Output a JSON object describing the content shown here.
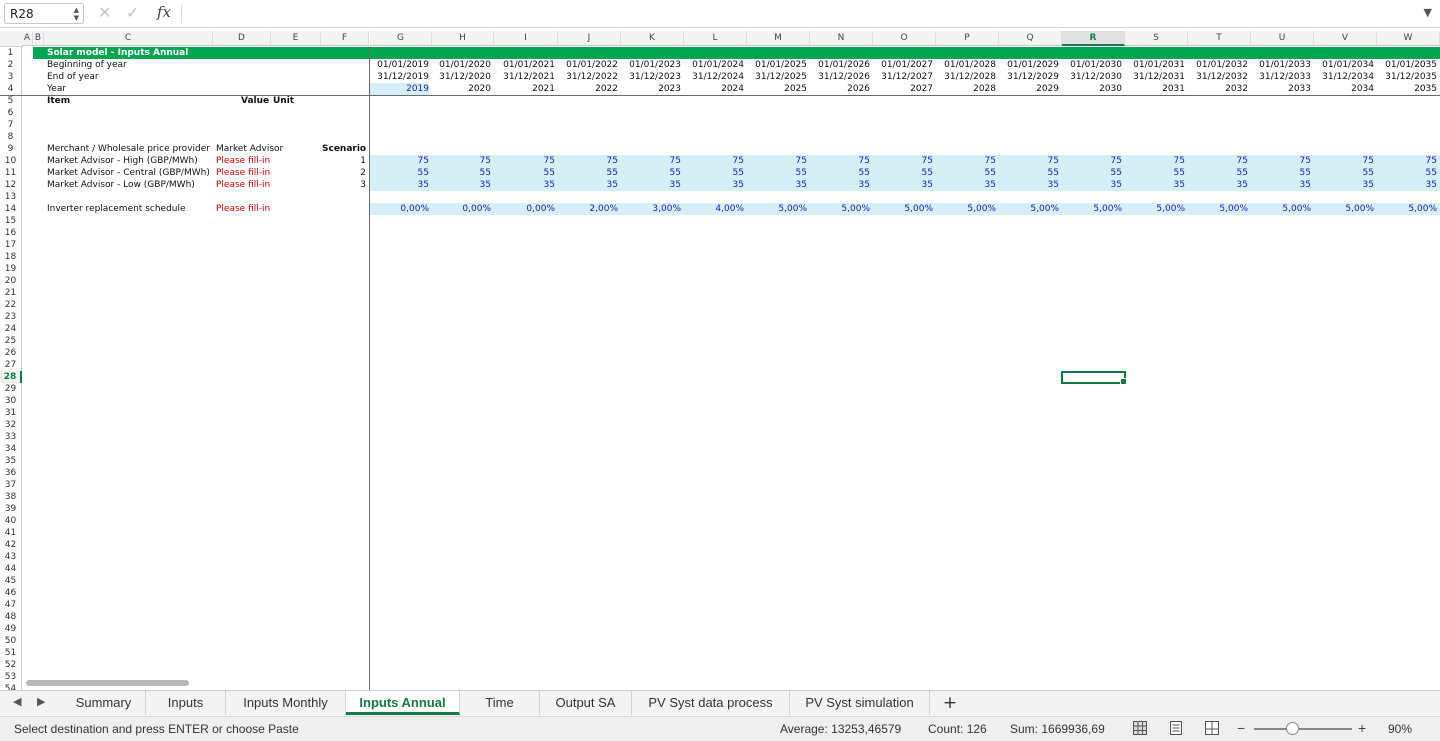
{
  "formula_bar": {
    "cell_ref": "R28",
    "fx_label": "fx",
    "formula": ""
  },
  "columns": [
    {
      "id": "A",
      "label": "A"
    },
    {
      "id": "B",
      "label": "B"
    },
    {
      "id": "C",
      "label": "C"
    },
    {
      "id": "D",
      "label": "D"
    },
    {
      "id": "E",
      "label": "E"
    },
    {
      "id": "F",
      "label": "F"
    },
    {
      "id": "G",
      "label": "G"
    },
    {
      "id": "H",
      "label": "H"
    },
    {
      "id": "I",
      "label": "I"
    },
    {
      "id": "J",
      "label": "J"
    },
    {
      "id": "K",
      "label": "K"
    },
    {
      "id": "L",
      "label": "L"
    },
    {
      "id": "M",
      "label": "M"
    },
    {
      "id": "N",
      "label": "N"
    },
    {
      "id": "O",
      "label": "O"
    },
    {
      "id": "P",
      "label": "P"
    },
    {
      "id": "Q",
      "label": "Q"
    },
    {
      "id": "R",
      "label": "R"
    },
    {
      "id": "S",
      "label": "S"
    },
    {
      "id": "T",
      "label": "T"
    },
    {
      "id": "U",
      "label": "U"
    },
    {
      "id": "V",
      "label": "V"
    },
    {
      "id": "W",
      "label": "W"
    }
  ],
  "selected_column": "R",
  "selected_row": 28,
  "row_count": 54,
  "sheet": {
    "title": "Solar model - Inputs Annual",
    "labels": {
      "beginning": "Beginning of year",
      "end": "End of year",
      "year": "Year",
      "item": "Item",
      "value": "Value",
      "unit": "Unit",
      "provider": "Merchant / Wholesale price provider",
      "provider_value": "Market Advisor",
      "scenario": "Scenario",
      "high": "Market Advisor - High (GBP/MWh)",
      "central": "Market Advisor - Central (GBP/MWh)",
      "low": "Market Advisor - Low (GBP/MWh)",
      "fill_in": "Please fill-in",
      "inverter": "Inverter replacement schedule"
    },
    "scenario_numbers": [
      "1",
      "2",
      "3"
    ],
    "period_columns": [
      {
        "col": "G",
        "begin": "01/01/2019",
        "end": "31/12/2019",
        "year": "2019",
        "high": "75",
        "central": "55",
        "low": "35",
        "inverter": "0,00%"
      },
      {
        "col": "H",
        "begin": "01/01/2020",
        "end": "31/12/2020",
        "year": "2020",
        "high": "75",
        "central": "55",
        "low": "35",
        "inverter": "0,00%"
      },
      {
        "col": "I",
        "begin": "01/01/2021",
        "end": "31/12/2021",
        "year": "2021",
        "high": "75",
        "central": "55",
        "low": "35",
        "inverter": "0,00%"
      },
      {
        "col": "J",
        "begin": "01/01/2022",
        "end": "31/12/2022",
        "year": "2022",
        "high": "75",
        "central": "55",
        "low": "35",
        "inverter": "2,00%"
      },
      {
        "col": "K",
        "begin": "01/01/2023",
        "end": "31/12/2023",
        "year": "2023",
        "high": "75",
        "central": "55",
        "low": "35",
        "inverter": "3,00%"
      },
      {
        "col": "L",
        "begin": "01/01/2024",
        "end": "31/12/2024",
        "year": "2024",
        "high": "75",
        "central": "55",
        "low": "35",
        "inverter": "4,00%"
      },
      {
        "col": "M",
        "begin": "01/01/2025",
        "end": "31/12/2025",
        "year": "2025",
        "high": "75",
        "central": "55",
        "low": "35",
        "inverter": "5,00%"
      },
      {
        "col": "N",
        "begin": "01/01/2026",
        "end": "31/12/2026",
        "year": "2026",
        "high": "75",
        "central": "55",
        "low": "35",
        "inverter": "5,00%"
      },
      {
        "col": "O",
        "begin": "01/01/2027",
        "end": "31/12/2027",
        "year": "2027",
        "high": "75",
        "central": "55",
        "low": "35",
        "inverter": "5,00%"
      },
      {
        "col": "P",
        "begin": "01/01/2028",
        "end": "31/12/2028",
        "year": "2028",
        "high": "75",
        "central": "55",
        "low": "35",
        "inverter": "5,00%"
      },
      {
        "col": "Q",
        "begin": "01/01/2029",
        "end": "31/12/2029",
        "year": "2029",
        "high": "75",
        "central": "55",
        "low": "35",
        "inverter": "5,00%"
      },
      {
        "col": "R",
        "begin": "01/01/2030",
        "end": "31/12/2030",
        "year": "2030",
        "high": "75",
        "central": "55",
        "low": "35",
        "inverter": "5,00%"
      },
      {
        "col": "S",
        "begin": "01/01/2031",
        "end": "31/12/2031",
        "year": "2031",
        "high": "75",
        "central": "55",
        "low": "35",
        "inverter": "5,00%"
      },
      {
        "col": "T",
        "begin": "01/01/2032",
        "end": "31/12/2032",
        "year": "2032",
        "high": "75",
        "central": "55",
        "low": "35",
        "inverter": "5,00%"
      },
      {
        "col": "U",
        "begin": "01/01/2033",
        "end": "31/12/2033",
        "year": "2033",
        "high": "75",
        "central": "55",
        "low": "35",
        "inverter": "5,00%"
      },
      {
        "col": "V",
        "begin": "01/01/2034",
        "end": "31/12/2034",
        "year": "2034",
        "high": "75",
        "central": "55",
        "low": "35",
        "inverter": "5,00%"
      },
      {
        "col": "W",
        "begin": "01/01/2035",
        "end": "31/12/2035",
        "year": "2035",
        "high": "75",
        "central": "55",
        "low": "35",
        "inverter": "5,00%"
      }
    ]
  },
  "tabs": [
    {
      "label": "Summary",
      "active": false
    },
    {
      "label": "Inputs",
      "active": false
    },
    {
      "label": "Inputs Monthly",
      "active": false
    },
    {
      "label": "Inputs Annual",
      "active": true
    },
    {
      "label": "Time",
      "active": false
    },
    {
      "label": "Output SA",
      "active": false
    },
    {
      "label": "PV Syst data process",
      "active": false
    },
    {
      "label": "PV Syst simulation",
      "active": false
    }
  ],
  "tab_add_label": "+",
  "status": {
    "message": "Select destination and press ENTER or choose Paste",
    "average": "Average: 13253,46579",
    "count": "Count: 126",
    "sum": "Sum: 1669936,69",
    "zoom": "90%",
    "zoom_fraction": 0.39
  },
  "colors": {
    "accent": "#107c41",
    "title_band": "#00a651",
    "input_band": "#d6eef6",
    "input_text": "#1a1acc",
    "warning": "#e00000"
  }
}
